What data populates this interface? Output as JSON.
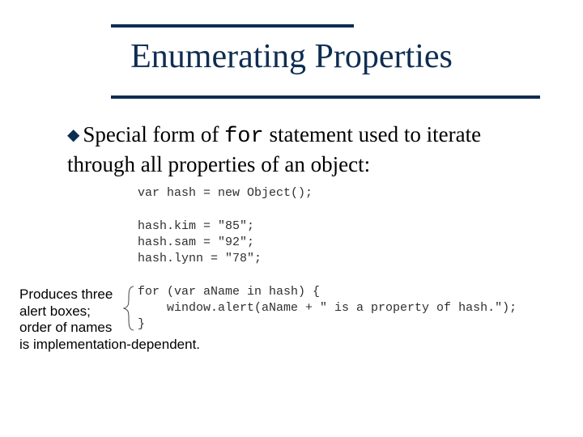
{
  "title": "Enumerating Properties",
  "bullet": {
    "pre": "Special form of ",
    "code": "for",
    "post": " statement used to iterate through all properties of an object:"
  },
  "code": {
    "l1": "var hash = new Object();",
    "l2": "",
    "l3": "hash.kim = \"85\";",
    "l4": "hash.sam = \"92\";",
    "l5": "hash.lynn = \"78\";",
    "l6": "",
    "l7": "for (var aName in hash) {",
    "l8": "    window.alert(aName + \" is a property of hash.\");",
    "l9": "}"
  },
  "annotation": {
    "l1": "Produces three",
    "l2": "alert boxes;",
    "l3": "order of names",
    "l4": "is implementation-dependent."
  }
}
